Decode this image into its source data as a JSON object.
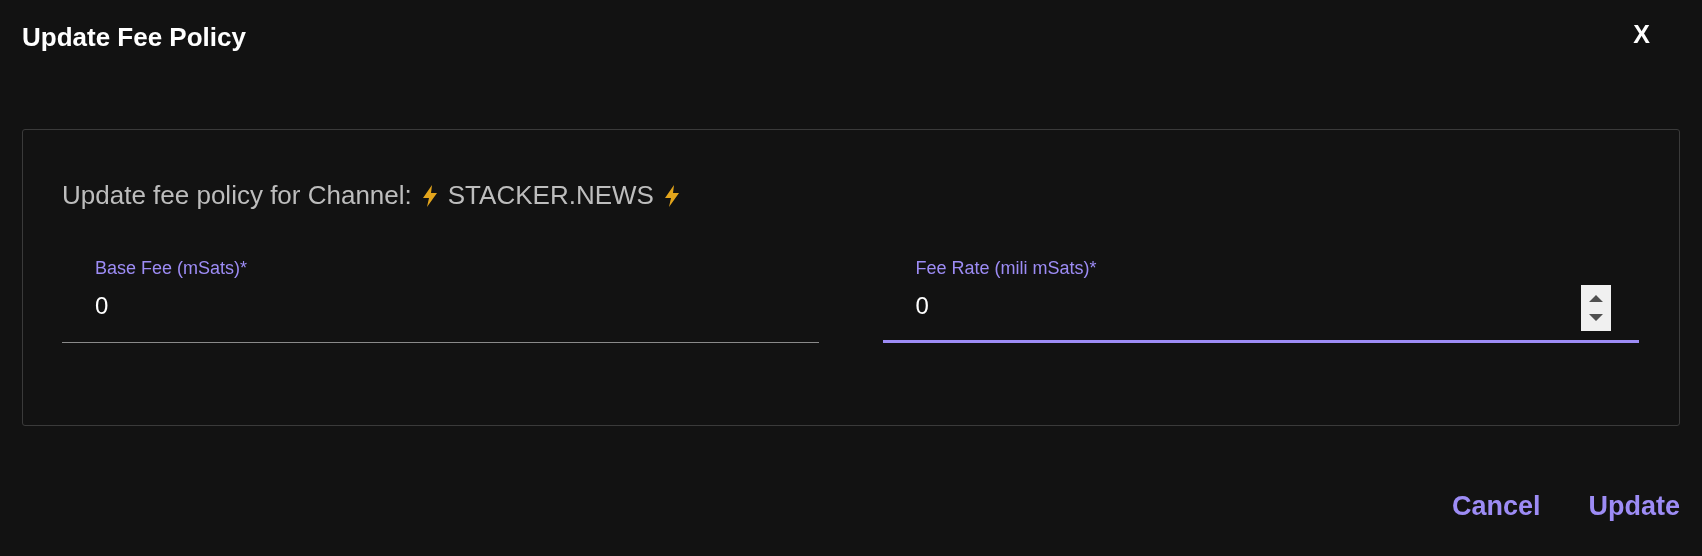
{
  "dialog": {
    "title": "Update Fee Policy",
    "close": "X"
  },
  "message": {
    "text": "Update fee policy for Channel:",
    "channel": "STACKER.NEWS"
  },
  "fields": [
    {
      "label": "Base Fee (mSats)*",
      "value": "0",
      "focused": false
    },
    {
      "label": "Fee Rate (mili mSats)*",
      "value": "0",
      "focused": true
    }
  ],
  "buttons": [
    "Cancel",
    "Update"
  ]
}
